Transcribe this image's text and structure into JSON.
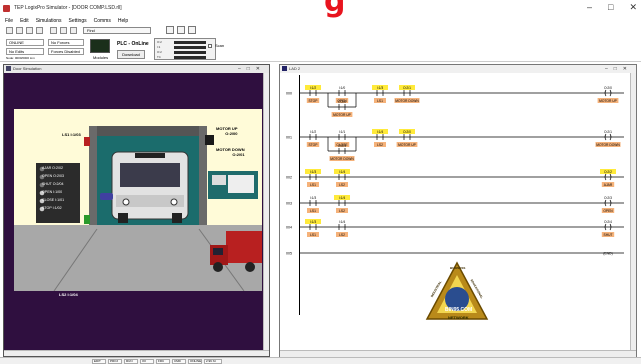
{
  "app": {
    "title": "TEP LogixPro Simulator - [DOOR COMP.LSD.rll]",
    "brand_glyph": "g"
  },
  "menu": [
    "File",
    "Edit",
    "Simulations",
    "Settings",
    "Comms",
    "Help"
  ],
  "toolbar": {
    "search_text": "Find"
  },
  "panel": {
    "mode_value": "ONLINE",
    "mode_sub": "No Forces",
    "fault_value": "No Edits",
    "fault_sub": "Forces Disabled",
    "node_label": "Node: 0000/0000 Lim",
    "module_label": "Modules",
    "plc_label": "PLC - OnLine",
    "download_label": "Download",
    "scan_label": "Scan",
    "io_labels": [
      "O:2",
      "I:1",
      "O:2",
      "T4"
    ]
  },
  "sim_window": {
    "title": "Door Simulation",
    "ls1": "LS1  I:1/03",
    "ls2": "LS2  I:1/04",
    "motor_up": "MOTOR UP\nO:2/00",
    "motor_down": "MOTOR DOWN\nO:2/01",
    "panel_items": [
      {
        "label": "AJAR",
        "addr": "O:2/02"
      },
      {
        "label": "OPEN",
        "addr": "O:2/03"
      },
      {
        "label": "SHUT",
        "addr": "O:2/04"
      },
      {
        "label": "OPEN",
        "addr": "I:1/00"
      },
      {
        "label": "CLOSE",
        "addr": "I:1/01"
      },
      {
        "label": "STOP",
        "addr": "I:1/02"
      }
    ]
  },
  "ladder_window": {
    "title": "LAD 2",
    "rungs": [
      {
        "num": "000",
        "contacts": [
          {
            "addr": "I:1/2",
            "tag": "STOP",
            "hl": true
          },
          {
            "addr": "I:1/0",
            "tag": "OPEN",
            "hl": false
          },
          {
            "addr": "I:1/3",
            "tag": "LS1",
            "hl": true
          },
          {
            "addr": "O:2/1",
            "tag": "MOTOR DOWN",
            "hl": true
          }
        ],
        "branch": {
          "addr": "O:2/0",
          "tag": "MOTOR UP"
        },
        "coil": {
          "addr": "O:2/0",
          "tag": "MOTOR UP"
        }
      },
      {
        "num": "001",
        "contacts": [
          {
            "addr": "I:1/2",
            "tag": "STOP",
            "hl": false
          },
          {
            "addr": "I:1/1",
            "tag": "CLOSE",
            "hl": false
          },
          {
            "addr": "I:1/4",
            "tag": "LS2",
            "hl": true
          },
          {
            "addr": "O:2/0",
            "tag": "MOTOR UP",
            "hl": true
          }
        ],
        "branch": {
          "addr": "O:2/1",
          "tag": "MOTOR DOWN"
        },
        "coil": {
          "addr": "O:2/1",
          "tag": "MOTOR DOWN"
        }
      },
      {
        "num": "002",
        "contacts": [
          {
            "addr": "I:1/3",
            "tag": "LS1",
            "hl": true
          },
          {
            "addr": "I:1/4",
            "tag": "LS2",
            "hl": true
          }
        ],
        "coil": {
          "addr": "O:2/2",
          "tag": "AJAR",
          "hl": true
        }
      },
      {
        "num": "003",
        "contacts": [
          {
            "addr": "I:1/3",
            "tag": "LS1",
            "hl": false
          },
          {
            "addr": "I:1/4",
            "tag": "LS2",
            "hl": true
          }
        ],
        "coil": {
          "addr": "O:2/3",
          "tag": "OPEN",
          "hl": false
        }
      },
      {
        "num": "004",
        "contacts": [
          {
            "addr": "I:1/3",
            "tag": "LS1",
            "hl": true
          },
          {
            "addr": "I:1/4",
            "tag": "LS2",
            "hl": false
          }
        ],
        "coil": {
          "addr": "O:2/4",
          "tag": "SHUT",
          "hl": false
        }
      },
      {
        "num": "005",
        "contacts": [],
        "coil": {
          "addr": "",
          "tag": "END",
          "hl": false
        }
      }
    ],
    "logo_top": "BUSINESS",
    "logo_left": "INDUSTRIAL",
    "logo_right": "EDUCATIONAL",
    "logo_main": "BIN95.COM",
    "logo_bottom": "NETWORK"
  },
  "status": [
    "EDIT",
    "PROJ",
    "RUN",
    "I/O",
    "FRC",
    "CMD",
    "ONLINE",
    "2.99 Xc"
  ],
  "colors": {
    "highlight": "#ffea3a",
    "tag_bg": "#f5b27a",
    "sim_bg": "#2f0f3f",
    "door_panel": "#207070"
  }
}
